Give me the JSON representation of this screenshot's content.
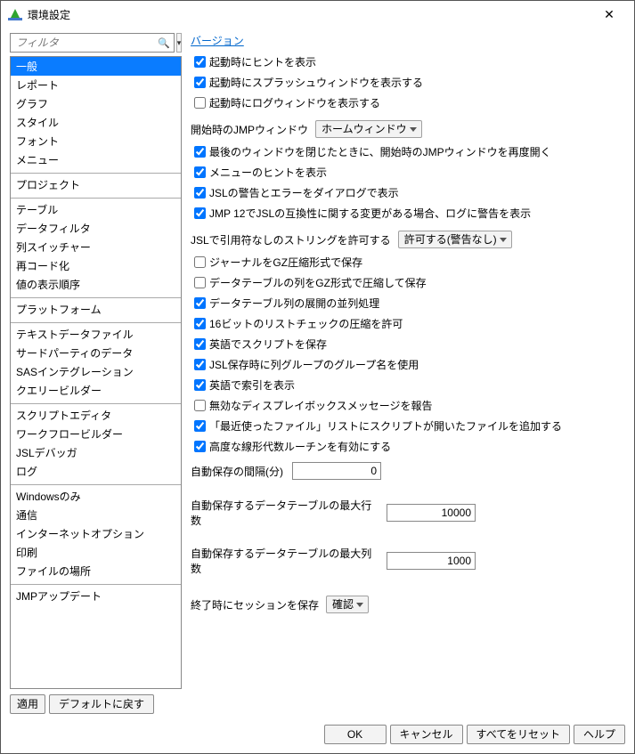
{
  "window": {
    "title": "環境設定"
  },
  "filter": {
    "placeholder": "フィルタ"
  },
  "nav": {
    "groups": [
      [
        "一般",
        "レポート",
        "グラフ",
        "スタイル",
        "フォント",
        "メニュー"
      ],
      [
        "プロジェクト"
      ],
      [
        "テーブル",
        "データフィルタ",
        "列スイッチャー",
        "再コード化",
        "値の表示順序"
      ],
      [
        "プラットフォーム"
      ],
      [
        "テキストデータファイル",
        "サードパーティのデータ",
        "SASインテグレーション",
        "クエリービルダー"
      ],
      [
        "スクリプトエディタ",
        "ワークフロービルダー",
        "JSLデバッガ",
        "ログ"
      ],
      [
        "Windowsのみ",
        "通信",
        "インターネットオプション",
        "印刷",
        "ファイルの場所"
      ],
      [
        "JMPアップデート"
      ]
    ],
    "selected": "一般"
  },
  "content": {
    "version_link": "バージョン",
    "cb_show_tips": "起動時にヒントを表示",
    "cb_show_splash": "起動時にスプラッシュウィンドウを表示する",
    "cb_show_log": "起動時にログウィンドウを表示する",
    "initial_window_label": "開始時のJMPウィンドウ",
    "initial_window_value": "ホームウィンドウ",
    "cb_reopen_last": "最後のウィンドウを閉じたときに、開始時のJMPウィンドウを再度開く",
    "cb_menu_tips": "メニューのヒントを表示",
    "cb_jsl_dialog": "JSLの警告とエラーをダイアログで表示",
    "cb_jmp12_compat": "JMP 12でJSLの互換性に関する変更がある場合、ログに警告を表示",
    "jsl_unquoted_label": "JSLで引用符なしのストリングを許可する",
    "jsl_unquoted_value": "許可する(警告なし)",
    "cb_journal_gz": "ジャーナルをGZ圧縮形式で保存",
    "cb_table_gz": "データテーブルの列をGZ形式で圧縮して保存",
    "cb_expand_parallel": "データテーブル列の展開の並列処理",
    "cb_16bit_list": "16ビットのリストチェックの圧縮を許可",
    "cb_eng_script_save": "英語でスクリプトを保存",
    "cb_jsl_group_name": "JSL保存時に列グループのグループ名を使用",
    "cb_eng_index": "英語で索引を表示",
    "cb_disp_box_msg": "無効なディスプレイボックスメッセージを報告",
    "cb_recent_scripts": "「最近使ったファイル」リストにスクリプトが開いたファイルを追加する",
    "cb_advanced_linalg": "高度な線形代数ルーチンを有効にする",
    "autosave_interval_label": "自動保存の間隔(分)",
    "autosave_interval_value": "0",
    "autosave_maxrows_label": "自動保存するデータテーブルの最大行数",
    "autosave_maxrows_value": "10000",
    "autosave_maxcols_label": "自動保存するデータテーブルの最大列数",
    "autosave_maxcols_value": "1000",
    "save_session_label": "終了時にセッションを保存",
    "save_session_value": "確認"
  },
  "buttons": {
    "apply": "適用",
    "reset_default": "デフォルトに戻す",
    "ok": "OK",
    "cancel": "キャンセル",
    "reset_all": "すべてをリセット",
    "help": "ヘルプ"
  }
}
